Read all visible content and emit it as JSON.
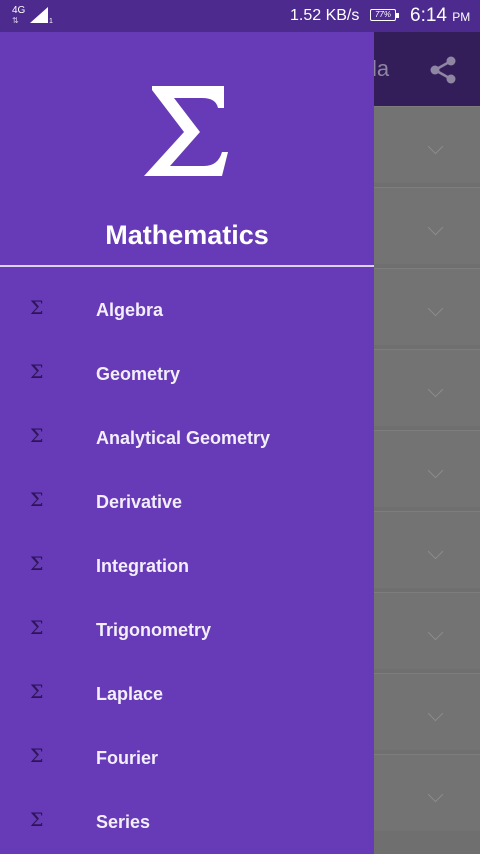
{
  "status_bar": {
    "network": "4G",
    "data_speed": "1.52 KB/s",
    "battery": "77%",
    "time": "6:14",
    "ampm": "PM",
    "icons": [
      "signal-icon",
      "battery-icon"
    ]
  },
  "background_app": {
    "title_partial": "la",
    "share_icon": "share-icon",
    "row_count": 9
  },
  "drawer": {
    "logo_icon": "sigma-icon",
    "title": "Mathematics",
    "item_icon": "Σ",
    "items": [
      {
        "label": "Algebra"
      },
      {
        "label": "Geometry"
      },
      {
        "label": "Analytical Geometry"
      },
      {
        "label": "Derivative"
      },
      {
        "label": "Integration"
      },
      {
        "label": "Trigonometry"
      },
      {
        "label": "Laplace"
      },
      {
        "label": "Fourier"
      },
      {
        "label": "Series"
      }
    ]
  },
  "colors": {
    "drawer_bg": "#673ab7",
    "status_bar_bg": "#4d2a8e",
    "item_icon": "#2d1456",
    "scrim_bg": "#737373"
  }
}
